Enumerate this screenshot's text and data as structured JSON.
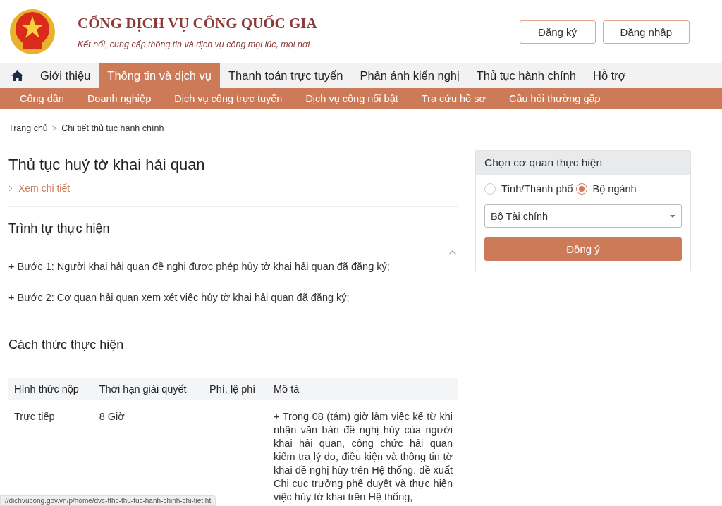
{
  "header": {
    "title": "CỔNG DỊCH VỤ CÔNG QUỐC GIA",
    "tagline": "Kết nối, cung cấp thông tin và dịch vụ công mọi lúc, mọi nơi",
    "buttons": [
      "Đăng ký",
      "Đăng nhập"
    ]
  },
  "main_nav": [
    {
      "label": "Giới thiệu",
      "selected": false
    },
    {
      "label": "Thông tin và dịch vụ",
      "selected": true
    },
    {
      "label": "Thanh toán trực tuyến",
      "selected": false
    },
    {
      "label": "Phản ánh kiến nghị",
      "selected": false
    },
    {
      "label": "Thủ tục hành chính",
      "selected": false
    },
    {
      "label": "Hỗ trợ",
      "selected": false
    }
  ],
  "sub_nav": [
    "Công dân",
    "Doanh nghiệp",
    "Dịch vụ công trực tuyến",
    "Dịch vụ công nổi bật",
    "Tra cứu hồ sơ",
    "Câu hỏi thường gặp"
  ],
  "breadcrumb": [
    "Trang chủ",
    "Chi tiết thủ tục hành chính"
  ],
  "breadcrumb_separator": ">",
  "page_title": "Thủ tục huỷ tờ khai hải quan",
  "detail_link": "Xem chi tiết",
  "sections": [
    {
      "heading": "Trình tự thực hiện",
      "expanded": true,
      "paragraphs": [
        "+ Bước 1: Người khai hải quan đề nghị được phép hủy tờ khai hải quan đã đăng ký;",
        "+ Bước 2: Cơ quan hải quan xem xét việc hủy tờ khai hải quan đã đăng ký;"
      ]
    },
    {
      "heading": "Cách thức thực hiện",
      "table": {
        "columns": [
          "Hình thức nộp",
          "Thời hạn giải quyết",
          "Phí, lệ phí",
          "Mô tả"
        ],
        "rows": [
          [
            "Trực tiếp",
            "8 Giờ",
            "",
            "+ Trong 08 (tám) giờ làm việc kể từ khi nhận văn bản đề nghị hủy của người khai hải quan, công chức hải quan kiểm tra lý do, điều kiện và thông tin tờ khai đề nghị hủy trên Hệ thống, đề xuất Chi cục trưởng phê duyệt và thực hiện việc hủy tờ khai trên Hệ thống,"
          ]
        ]
      }
    }
  ],
  "agency_panel": {
    "title": "Chọn cơ quan thực hiện",
    "options": [
      {
        "label": "Tỉnh/Thành phố",
        "selected": false
      },
      {
        "label": "Bộ ngành",
        "selected": true
      }
    ],
    "select_value": "Bộ Tài chính",
    "submit": "Đồng ý"
  },
  "status_url": "//dichvucong.gov.vn/p/home/dvc-tthc-thu-tuc-hanh-chinh-chi-tiet.ht"
}
